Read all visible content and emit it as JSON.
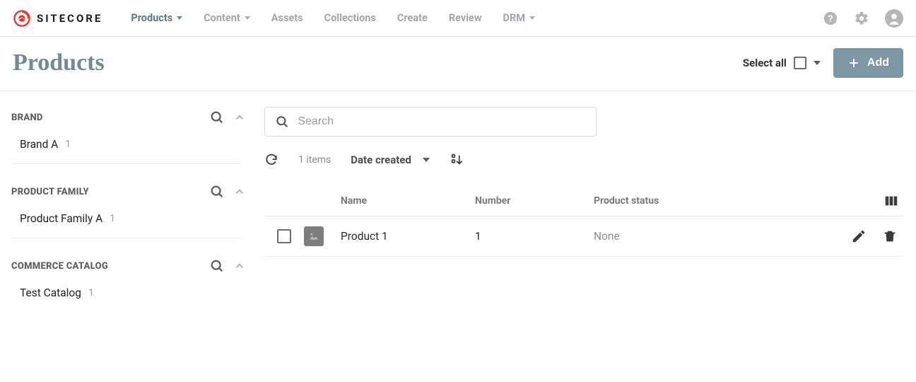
{
  "brand": {
    "name": "SITECORE"
  },
  "nav": {
    "items": [
      {
        "label": "Products",
        "active": true,
        "dropdown": true
      },
      {
        "label": "Content",
        "active": false,
        "dropdown": true
      },
      {
        "label": "Assets",
        "active": false,
        "dropdown": false
      },
      {
        "label": "Collections",
        "active": false,
        "dropdown": false
      },
      {
        "label": "Create",
        "active": false,
        "dropdown": false
      },
      {
        "label": "Review",
        "active": false,
        "dropdown": false
      },
      {
        "label": "DRM",
        "active": false,
        "dropdown": true
      }
    ]
  },
  "page": {
    "title": "Products",
    "select_all_label": "Select all",
    "add_label": "Add"
  },
  "sidebar": {
    "facets": [
      {
        "title": "BRAND",
        "items": [
          {
            "label": "Brand A",
            "count": "1"
          }
        ]
      },
      {
        "title": "PRODUCT FAMILY",
        "items": [
          {
            "label": "Product Family A",
            "count": "1"
          }
        ]
      },
      {
        "title": "COMMERCE CATALOG",
        "items": [
          {
            "label": "Test Catalog",
            "count": "1"
          }
        ]
      }
    ]
  },
  "main": {
    "search_placeholder": "Search",
    "count_label": "1 items",
    "sort_label": "Date created",
    "columns": {
      "name": "Name",
      "number": "Number",
      "status": "Product status"
    },
    "rows": [
      {
        "name": "Product 1",
        "number": "1",
        "status": "None"
      }
    ]
  }
}
